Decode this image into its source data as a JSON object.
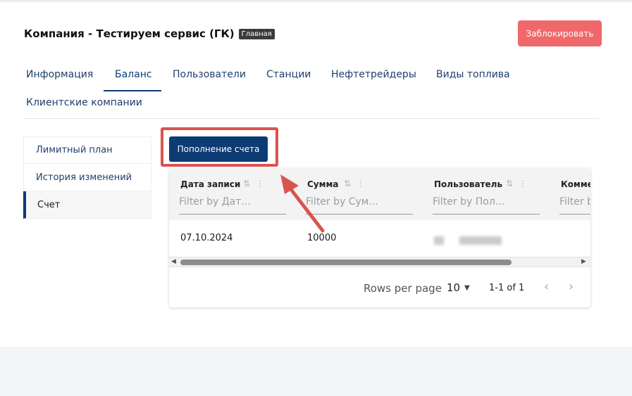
{
  "header": {
    "title": "Компания - Тестируем сервис (ГК)",
    "badge": "Главная",
    "block_button": "Заблокировать"
  },
  "tabs": [
    {
      "label": "Информация",
      "active": false
    },
    {
      "label": "Баланс",
      "active": true
    },
    {
      "label": "Пользователи",
      "active": false
    },
    {
      "label": "Станции",
      "active": false
    },
    {
      "label": "Нефтетрейдеры",
      "active": false
    },
    {
      "label": "Виды топлива",
      "active": false
    },
    {
      "label": "Клиентские компании",
      "active": false
    }
  ],
  "sidebar": {
    "items": [
      {
        "label": "Лимитный план",
        "active": false
      },
      {
        "label": "История изменений",
        "active": false
      },
      {
        "label": "Счет",
        "active": true
      }
    ]
  },
  "balance": {
    "topup_button": "Пополнение счета"
  },
  "grid": {
    "columns": [
      {
        "title": "Дата записи",
        "filter_placeholder": "Filter by Дат..."
      },
      {
        "title": "Сумма",
        "filter_placeholder": "Filter by Сум..."
      },
      {
        "title": "Пользователь",
        "filter_placeholder": "Filter by Пол..."
      },
      {
        "title": "Комме",
        "filter_placeholder": "Filter b"
      }
    ],
    "rows": [
      {
        "date": "07.10.2024",
        "amount": "10000",
        "user": ""
      }
    ],
    "footer": {
      "rows_per_page_label": "Rows per page",
      "rows_per_page_value": "10",
      "range": "1-1 of 1"
    }
  },
  "icons": {
    "sort": "sort-arrows-icon",
    "column_menu": "vertical-dots-icon",
    "dropdown": "caret-down-icon",
    "prev": "chevron-left-icon",
    "next": "chevron-right-icon"
  },
  "colors": {
    "primary": "#0d3b73",
    "danger": "#f0686a",
    "annotation": "#d9544f"
  }
}
